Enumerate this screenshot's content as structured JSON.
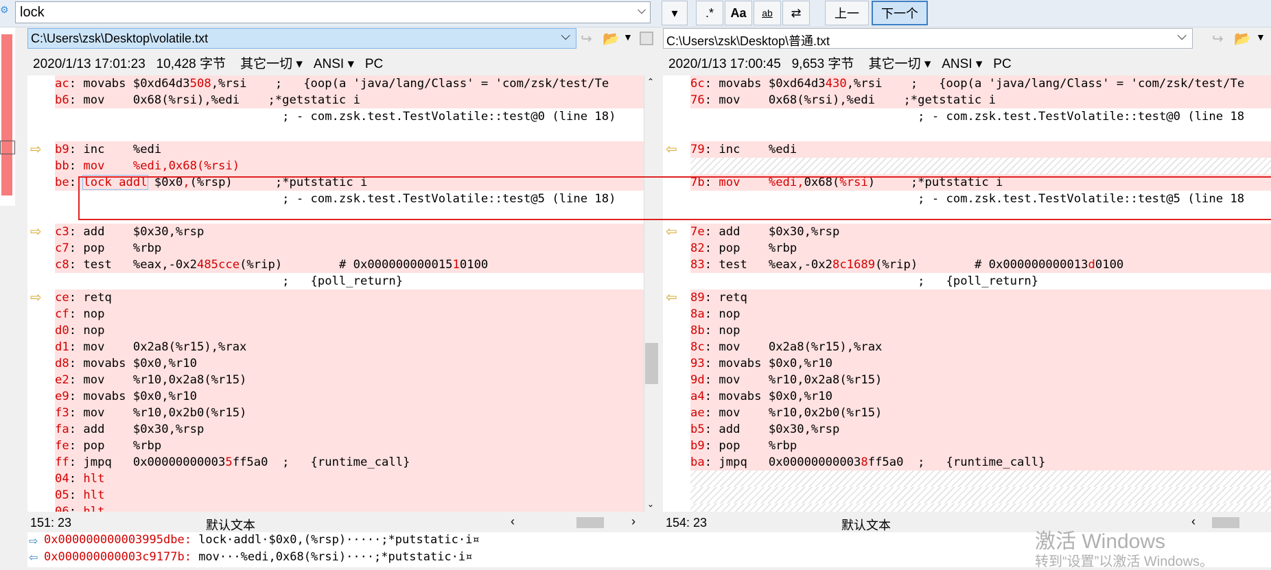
{
  "search": {
    "value": "lock"
  },
  "toolbar": {
    "regex_label": ".*",
    "case_label": "Aa",
    "word_label": "ab",
    "prev_label": "上一",
    "next_label": "下一个"
  },
  "left": {
    "path": "C:\\Users\\zsk\\Desktop\\volatile.txt",
    "date": "2020/1/13 17:01:23",
    "size": "10,428 字节",
    "other": "其它一切",
    "encoding": "ANSI",
    "eol": "PC",
    "position": "151: 23",
    "text_type": "默认文本",
    "lines": [
      {
        "addr": "ac",
        "text": " movabs $0xd64d3",
        "hl": "508",
        "rest": ",%rsi    ;   {oop(a 'java/lang/Class' = 'com/zsk/test/Te",
        "bg": "diff"
      },
      {
        "addr": "b6",
        "text": " mov    0x68(%rsi),%edi    ;*getstatic i",
        "bg": "diff"
      },
      {
        "addr": "",
        "text": "                                ; - com.zsk.test.TestVolatile::test@0 (line 18)",
        "bg": "white"
      },
      {
        "addr": "",
        "text": "",
        "bg": "white"
      },
      {
        "addr": "b9",
        "text": " inc    %edi",
        "bg": "diff",
        "arrow": true
      },
      {
        "addr": "bb",
        "redall": " mov    %edi,0x68(%rsi)",
        "bg": "diff"
      },
      {
        "addr": "be",
        "lock": true,
        "bg": "diff"
      },
      {
        "addr": "",
        "text": "                                ; - com.zsk.test.TestVolatile::test@5 (line 18)",
        "bg": "white"
      },
      {
        "addr": "",
        "text": "",
        "bg": "white"
      },
      {
        "addr": "c3",
        "text": " add    $0x30,%rsp",
        "bg": "diff",
        "arrow": true
      },
      {
        "addr": "c7",
        "text": " pop    %rbp",
        "bg": "diff"
      },
      {
        "addr": "c8",
        "text": " test   %eax,-0x2",
        "hl": "485cce",
        "rest": "(%rip)        # 0x000000000015",
        "hl2": "1",
        "rest2": "0100",
        "bg": "diff"
      },
      {
        "addr": "",
        "text": "                                ;   {poll_return}",
        "bg": "white"
      },
      {
        "addr": "ce",
        "text": " retq",
        "bg": "diff",
        "arrow": true
      },
      {
        "addr": "cf",
        "text": " nop",
        "bg": "diff"
      },
      {
        "addr": "d0",
        "text": " nop",
        "bg": "diff"
      },
      {
        "addr": "d1",
        "text": " mov    0x2a8(%r15),%rax",
        "bg": "diff"
      },
      {
        "addr": "d8",
        "text": " movabs $0x0,%r10",
        "bg": "diff"
      },
      {
        "addr": "e2",
        "text": " mov    %r10,0x2a8(%r15)",
        "bg": "diff"
      },
      {
        "addr": "e9",
        "text": " movabs $0x0,%r10",
        "bg": "diff"
      },
      {
        "addr": "f3",
        "text": " mov    %r10,0x2b0(%r15)",
        "bg": "diff"
      },
      {
        "addr": "fa",
        "text": " add    $0x30,%rsp",
        "bg": "diff"
      },
      {
        "addr": "fe",
        "text": " pop    %rbp",
        "bg": "diff"
      },
      {
        "addr": "ff",
        "text": " jmpq   0x00000000003",
        "hl": "5",
        "rest": "ff5a0  ;   {runtime_call}",
        "bg": "diff"
      },
      {
        "addr": "04",
        "redall": " hlt",
        "bg": "diff"
      },
      {
        "addr": "05",
        "redall": " hlt",
        "bg": "diff"
      },
      {
        "addr": "06",
        "redall": " hlt",
        "bg": "diff"
      }
    ]
  },
  "right": {
    "path": "C:\\Users\\zsk\\Desktop\\普通.txt",
    "date": "2020/1/13 17:00:45",
    "size": "9,653 字节",
    "other": "其它一切",
    "encoding": "ANSI",
    "eol": "PC",
    "position": "154: 23",
    "text_type": "默认文本",
    "lines": [
      {
        "addr": "6c",
        "text": " movabs $0xd64d3",
        "hl": "430",
        "rest": ",%rsi    ;   {oop(a 'java/lang/Class' = 'com/zsk/test/Te",
        "bg": "diff"
      },
      {
        "addr": "76",
        "text": " mov    0x68(%rsi),%edi    ;*getstatic i",
        "bg": "diff"
      },
      {
        "addr": "",
        "text": "                                ; - com.zsk.test.TestVolatile::test@0 (line 18",
        "bg": "white"
      },
      {
        "addr": "",
        "text": "",
        "bg": "white"
      },
      {
        "addr": "79",
        "text": " inc    %edi",
        "bg": "diff",
        "arrow": true
      },
      {
        "addr": "",
        "text": "",
        "bg": "hatch"
      },
      {
        "addr": "7b",
        "redmov": true,
        "bg": "diff"
      },
      {
        "addr": "",
        "text": "                                ; - com.zsk.test.TestVolatile::test@5 (line 18",
        "bg": "white"
      },
      {
        "addr": "",
        "text": "",
        "bg": "white"
      },
      {
        "addr": "7e",
        "text": " add    $0x30,%rsp",
        "bg": "diff",
        "arrow": true
      },
      {
        "addr": "82",
        "text": " pop    %rbp",
        "bg": "diff"
      },
      {
        "addr": "83",
        "text": " test   %eax,-0x2",
        "hl": "8c1689",
        "rest": "(%rip)        # 0x000000000013",
        "hl2": "d",
        "rest2": "0100",
        "bg": "diff"
      },
      {
        "addr": "",
        "text": "                                ;   {poll_return}",
        "bg": "white"
      },
      {
        "addr": "89",
        "text": " retq",
        "bg": "diff",
        "arrow": true
      },
      {
        "addr": "8a",
        "text": " nop",
        "bg": "diff"
      },
      {
        "addr": "8b",
        "text": " nop",
        "bg": "diff"
      },
      {
        "addr": "8c",
        "text": " mov    0x2a8(%r15),%rax",
        "bg": "diff"
      },
      {
        "addr": "93",
        "text": " movabs $0x0,%r10",
        "bg": "diff"
      },
      {
        "addr": "9d",
        "text": " mov    %r10,0x2a8(%r15)",
        "bg": "diff"
      },
      {
        "addr": "a4",
        "text": " movabs $0x0,%r10",
        "bg": "diff"
      },
      {
        "addr": "ae",
        "text": " mov    %r10,0x2b0(%r15)",
        "bg": "diff"
      },
      {
        "addr": "b5",
        "text": " add    $0x30,%rsp",
        "bg": "diff"
      },
      {
        "addr": "b9",
        "text": " pop    %rbp",
        "bg": "diff"
      },
      {
        "addr": "ba",
        "text": " jmpq   0x00000000003",
        "hl": "8",
        "rest": "ff5a0  ;   {runtime_call}",
        "bg": "diff"
      },
      {
        "addr": "",
        "text": "",
        "bg": "hatch"
      },
      {
        "addr": "",
        "text": "",
        "bg": "hatch"
      },
      {
        "addr": "",
        "text": "",
        "bg": "hatch"
      }
    ]
  },
  "bottom": {
    "line1_addr": "0x000000000003995dbe:",
    "line1_text": "lock·addl·$0x0,(%rsp)·····;*putstatic·i¤",
    "line2_addr": "0x000000000003c9177b:",
    "line2_text": "mov···%edi,0x68(%rsi)····;*putstatic·i¤"
  },
  "watermark": {
    "line1": "激活 Windows",
    "line2": "转到“设置”以激活 Windows。"
  },
  "colors": {
    "diff_bg": "#ffe1e1",
    "red": "#d40000",
    "accent": "#3d8fd8"
  }
}
